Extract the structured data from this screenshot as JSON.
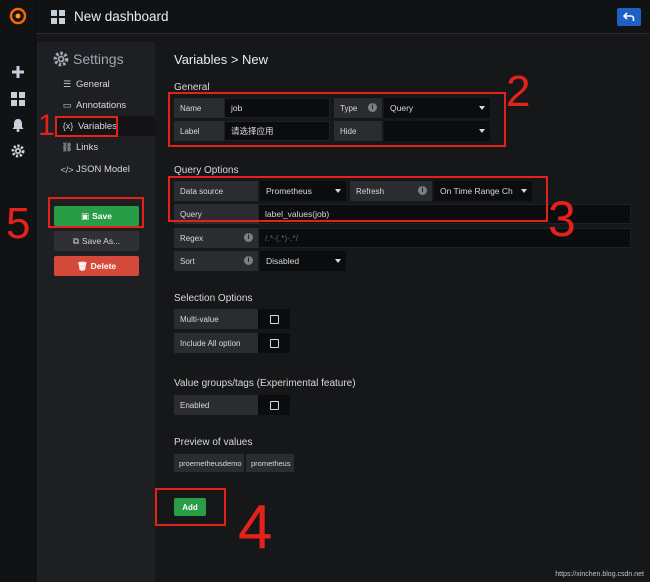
{
  "app": {
    "dashboard_title": "New dashboard"
  },
  "settings": {
    "title": "Settings",
    "items": [
      {
        "label": "General",
        "icon": "sliders-icon"
      },
      {
        "label": "Annotations",
        "icon": "comment-icon"
      },
      {
        "label": "Variables",
        "icon": "variable-icon"
      },
      {
        "label": "Links",
        "icon": "link-icon"
      },
      {
        "label": "JSON Model",
        "icon": "code-icon"
      }
    ],
    "save_label": "Save",
    "save_as_label": "Save As...",
    "delete_label": "Delete"
  },
  "main": {
    "breadcrumb": "Variables > New",
    "general": {
      "heading": "General",
      "name_label": "Name",
      "name_value": "job",
      "type_label": "Type",
      "type_value": "Query",
      "label_label": "Label",
      "label_value": "请选择应用",
      "hide_label": "Hide",
      "hide_value": ""
    },
    "query_options": {
      "heading": "Query Options",
      "datasource_label": "Data source",
      "datasource_value": "Prometheus",
      "refresh_label": "Refresh",
      "refresh_value": "On Time Range Ch",
      "query_label": "Query",
      "query_value": "label_values(job)",
      "regex_label": "Regex",
      "regex_placeholder": "/.*-(.*)-.*/",
      "sort_label": "Sort",
      "sort_value": "Disabled"
    },
    "selection_options": {
      "heading": "Selection Options",
      "multi_value_label": "Multi-value",
      "include_all_label": "Include All option"
    },
    "value_groups": {
      "heading": "Value groups/tags (Experimental feature)",
      "enabled_label": "Enabled"
    },
    "preview": {
      "heading": "Preview of values",
      "values": [
        "proemetheusdemo",
        "prometheus"
      ]
    },
    "add_label": "Add"
  },
  "annotations": {
    "numbers": [
      "1",
      "2",
      "3",
      "4",
      "5"
    ],
    "color": "#e3221c"
  },
  "watermark": "https://xinchen.blog.csdn.net"
}
